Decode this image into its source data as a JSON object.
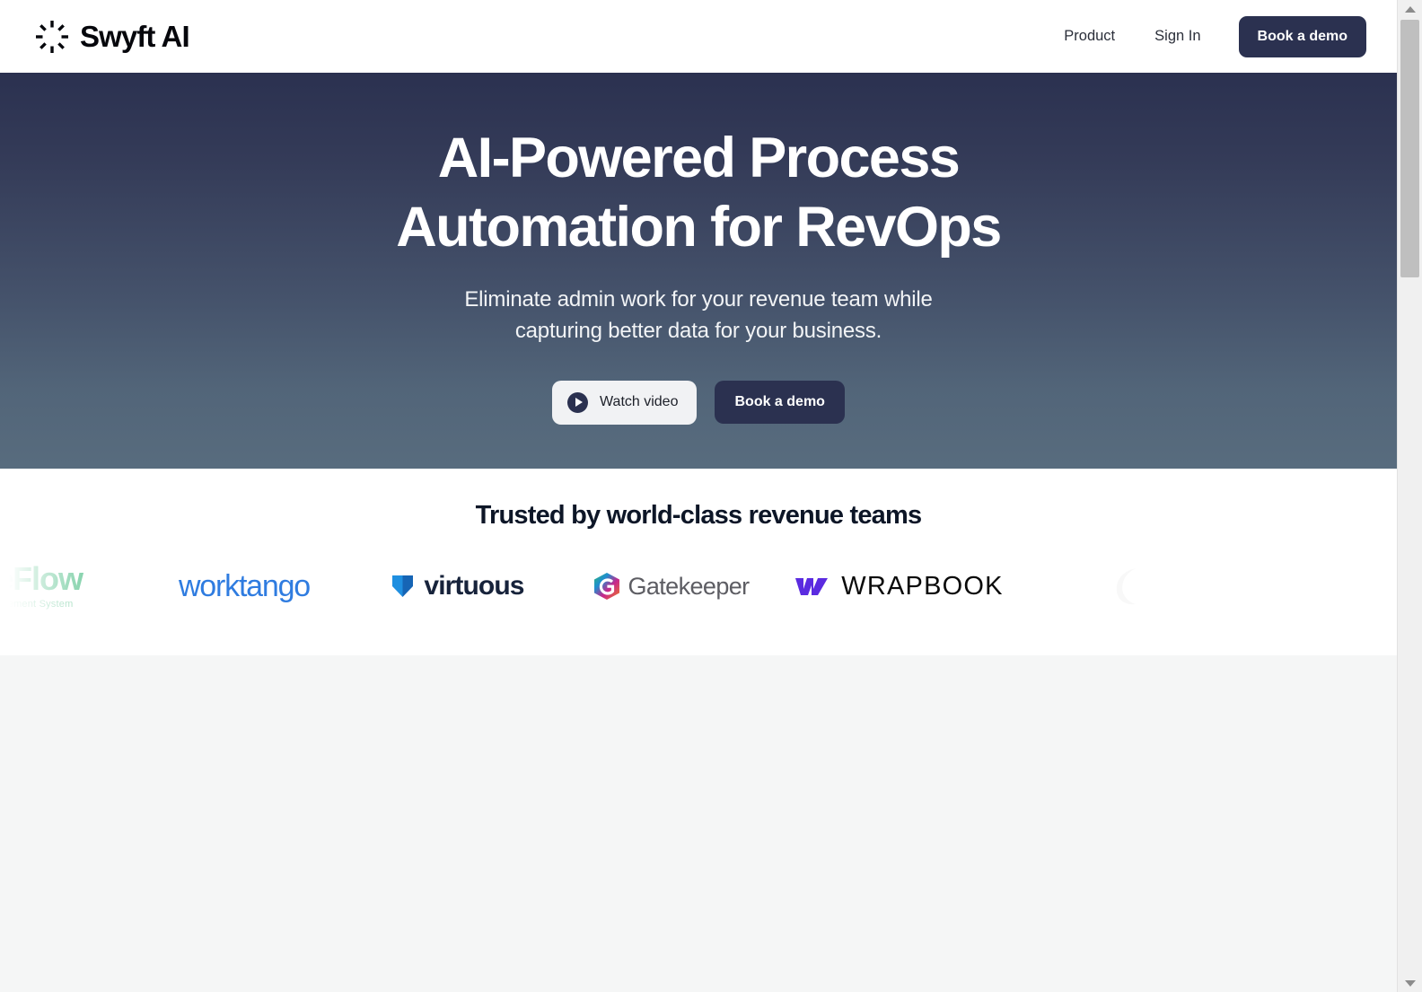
{
  "header": {
    "brand_name": "Swyft AI",
    "logo_icon": "sunburst-spinner-icon",
    "nav": [
      {
        "label": "Product",
        "name": "product"
      },
      {
        "label": "Sign In",
        "name": "sign-in"
      }
    ],
    "cta_label": "Book a demo"
  },
  "hero": {
    "title_line1": "AI-Powered Process",
    "title_line2": "Automation for RevOps",
    "subtitle_line1": "Eliminate admin work for your revenue team while",
    "subtitle_line2": "capturing better data for your business.",
    "watch_label": "Watch video",
    "watch_icon": "play-icon",
    "demo_label": "Book a demo",
    "gradient_top": "#2b3150",
    "gradient_bottom": "#586c7e"
  },
  "trusted": {
    "title": "Trusted by world-class revenue teams",
    "logos": [
      {
        "name": "eeflow",
        "text": "eeFlow",
        "tagline": "Placement System",
        "color": "#53c08a"
      },
      {
        "name": "worktango",
        "text": "worktango",
        "color": "#2f7ce0"
      },
      {
        "name": "virtuous",
        "text": "virtuous",
        "color": "#17233b",
        "mark_color": "#1f8fe0"
      },
      {
        "name": "gatekeeper",
        "text": "Gatekeeper",
        "color": "#5d5d63"
      },
      {
        "name": "wrapbook",
        "text": "WRAPBOOK",
        "color": "#0a0a0a",
        "mark_color": "#5b2be0"
      },
      {
        "name": "partial-logo",
        "text": "",
        "color": "#e8e8e8"
      }
    ]
  },
  "lower": {
    "background": "#f5f6f6"
  },
  "scrollbar": {
    "up_icon": "scroll-up-arrow",
    "down_icon": "scroll-down-arrow"
  },
  "colors": {
    "brand_navy": "#2b3150",
    "page_white": "#ffffff",
    "section_gray": "#f5f6f6"
  }
}
